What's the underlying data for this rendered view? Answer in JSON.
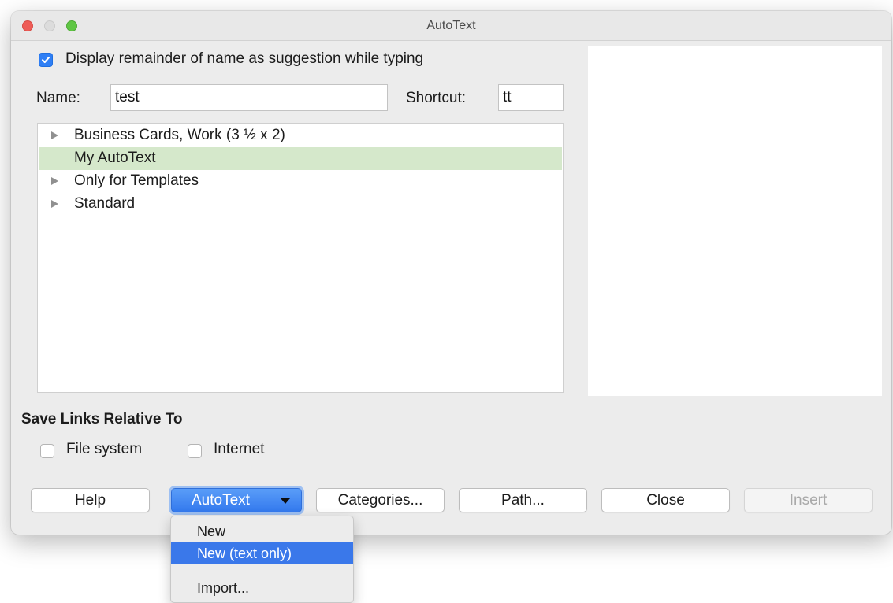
{
  "window": {
    "title": "AutoText"
  },
  "suggestion_checkbox": {
    "label": "Display remainder of name as suggestion while typing",
    "checked": true
  },
  "name_field": {
    "label": "Name:",
    "value": "test"
  },
  "shortcut_field": {
    "label": "Shortcut:",
    "value": "tt"
  },
  "tree": {
    "items": [
      {
        "label": "Business Cards, Work (3 ½ x 2)",
        "expandable": true,
        "selected": false
      },
      {
        "label": "My AutoText",
        "expandable": false,
        "selected": true
      },
      {
        "label": "Only for Templates",
        "expandable": true,
        "selected": false
      },
      {
        "label": "Standard",
        "expandable": true,
        "selected": false
      }
    ]
  },
  "save_links": {
    "heading": "Save Links Relative To",
    "options": [
      {
        "label": "File system",
        "checked": false
      },
      {
        "label": "Internet",
        "checked": false
      }
    ]
  },
  "buttons": {
    "help": "Help",
    "autotext": "AutoText",
    "categories": "Categories...",
    "path": "Path...",
    "close": "Close",
    "insert": "Insert"
  },
  "autotext_menu": {
    "items": [
      {
        "label": "New",
        "highlighted": false
      },
      {
        "label": "New (text only)",
        "highlighted": true
      },
      {
        "label": "Import...",
        "highlighted": false
      }
    ]
  },
  "colors": {
    "accent_blue": "#3379ee",
    "selection_green": "#d5e8cb",
    "close_light": "#ee5c57",
    "zoom_light": "#5fc644"
  }
}
